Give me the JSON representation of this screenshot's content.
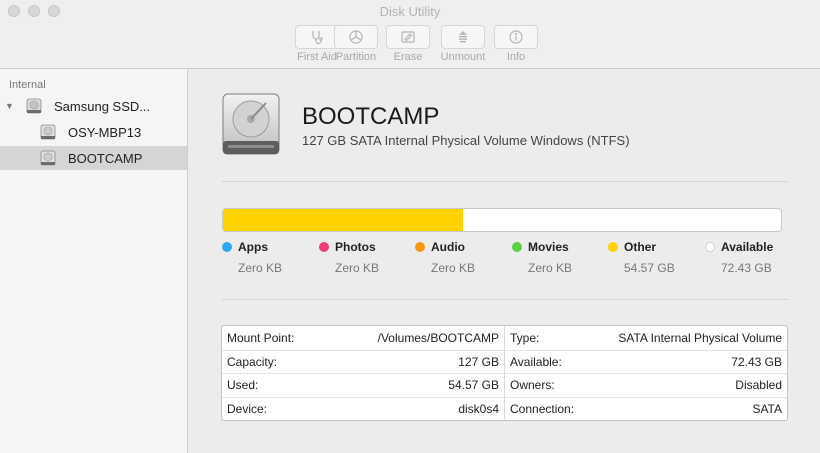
{
  "window": {
    "title": "Disk Utility"
  },
  "toolbar": [
    {
      "label": "First Aid",
      "icon": "stethoscope-icon"
    },
    {
      "label": "Partition",
      "icon": "partition-icon"
    },
    {
      "label": "Erase",
      "icon": "erase-icon"
    },
    {
      "label": "Unmount",
      "icon": "unmount-icon"
    },
    {
      "label": "Info",
      "icon": "info-icon"
    }
  ],
  "sidebar": {
    "section_label": "Internal",
    "items": [
      {
        "label": "Samsung SSD...",
        "icon": "internal-disk-icon",
        "level": 0,
        "expanded": true
      },
      {
        "label": "OSY-MBP13",
        "icon": "volume-icon",
        "level": 1
      },
      {
        "label": "BOOTCAMP",
        "icon": "volume-icon",
        "level": 1,
        "selected": true
      }
    ]
  },
  "volume": {
    "name": "BOOTCAMP",
    "description": "127 GB SATA Internal Physical Volume Windows (NTFS)"
  },
  "usage": {
    "total_gb": 127,
    "used_fraction": 0.4297,
    "categories": [
      {
        "name": "Apps",
        "size": "Zero KB",
        "color": "#2fa8f0"
      },
      {
        "name": "Photos",
        "size": "Zero KB",
        "color": "#ef3f7c"
      },
      {
        "name": "Audio",
        "size": "Zero KB",
        "color": "#f39a13"
      },
      {
        "name": "Movies",
        "size": "Zero KB",
        "color": "#5bcf45"
      },
      {
        "name": "Other",
        "size": "54.57 GB",
        "color": "#ffd200"
      },
      {
        "name": "Available",
        "size": "72.43 GB",
        "color": "#ffffff"
      }
    ]
  },
  "info": {
    "left": [
      {
        "label": "Mount Point:",
        "value": "/Volumes/BOOTCAMP"
      },
      {
        "label": "Capacity:",
        "value": "127 GB"
      },
      {
        "label": "Used:",
        "value": "54.57 GB"
      },
      {
        "label": "Device:",
        "value": "disk0s4"
      }
    ],
    "right": [
      {
        "label": "Type:",
        "value": "SATA Internal Physical Volume"
      },
      {
        "label": "Available:",
        "value": "72.43 GB"
      },
      {
        "label": "Owners:",
        "value": "Disabled"
      },
      {
        "label": "Connection:",
        "value": "SATA"
      }
    ]
  }
}
